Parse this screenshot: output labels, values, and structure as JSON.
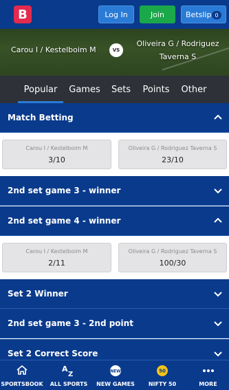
{
  "header": {
    "logo_letter": "B",
    "login_label": "Log In",
    "join_label": "Join",
    "betslip_label": "Betslip",
    "betslip_count": "0"
  },
  "match": {
    "player1": "Carou I / Kestelboim M",
    "vs": "VS",
    "player2_line1": "Oliveira G / Rodriguez",
    "player2_line2": "Taverna S"
  },
  "tabs": [
    {
      "label": "Popular",
      "active": true
    },
    {
      "label": "Games",
      "active": false
    },
    {
      "label": "Sets",
      "active": false
    },
    {
      "label": "Points",
      "active": false
    },
    {
      "label": "Other",
      "active": false
    }
  ],
  "markets": [
    {
      "title": "Match Betting",
      "expanded": true,
      "odds": [
        {
          "name": "Carou I / Kestelboim M",
          "price": "3/10"
        },
        {
          "name": "Oliveira G / Rodriguez Taverna S",
          "price": "23/10"
        }
      ]
    },
    {
      "title": "2nd set game 3 - winner",
      "expanded": false
    },
    {
      "title": "2nd set game 4 - winner",
      "expanded": true,
      "odds": [
        {
          "name": "Carou I / Kestelboim M",
          "price": "2/11"
        },
        {
          "name": "Oliveira G / Rodriguez Taverna S",
          "price": "100/30"
        }
      ]
    },
    {
      "title": "Set 2 Winner",
      "expanded": false
    },
    {
      "title": "2nd set game 3 - 2nd point",
      "expanded": false
    },
    {
      "title": "Set 2 Correct Score",
      "expanded": false
    }
  ],
  "bottom_nav": [
    {
      "label": "SPORTSBOOK",
      "icon": "home-icon"
    },
    {
      "label": "ALL SPORTS",
      "icon": "az-icon"
    },
    {
      "label": "NEW GAMES",
      "icon": "new-badge-icon",
      "icon_text": "NEW"
    },
    {
      "label": "NIFTY 50",
      "icon": "nifty-icon",
      "icon_text": "50"
    },
    {
      "label": "MORE",
      "icon": "more-icon"
    }
  ],
  "colors": {
    "primary": "#0a3a8c",
    "accent_blue": "#2a7bd6",
    "join_green": "#1aa84a",
    "logo_red": "#e32a4f",
    "tab_bar": "#2e3138"
  }
}
